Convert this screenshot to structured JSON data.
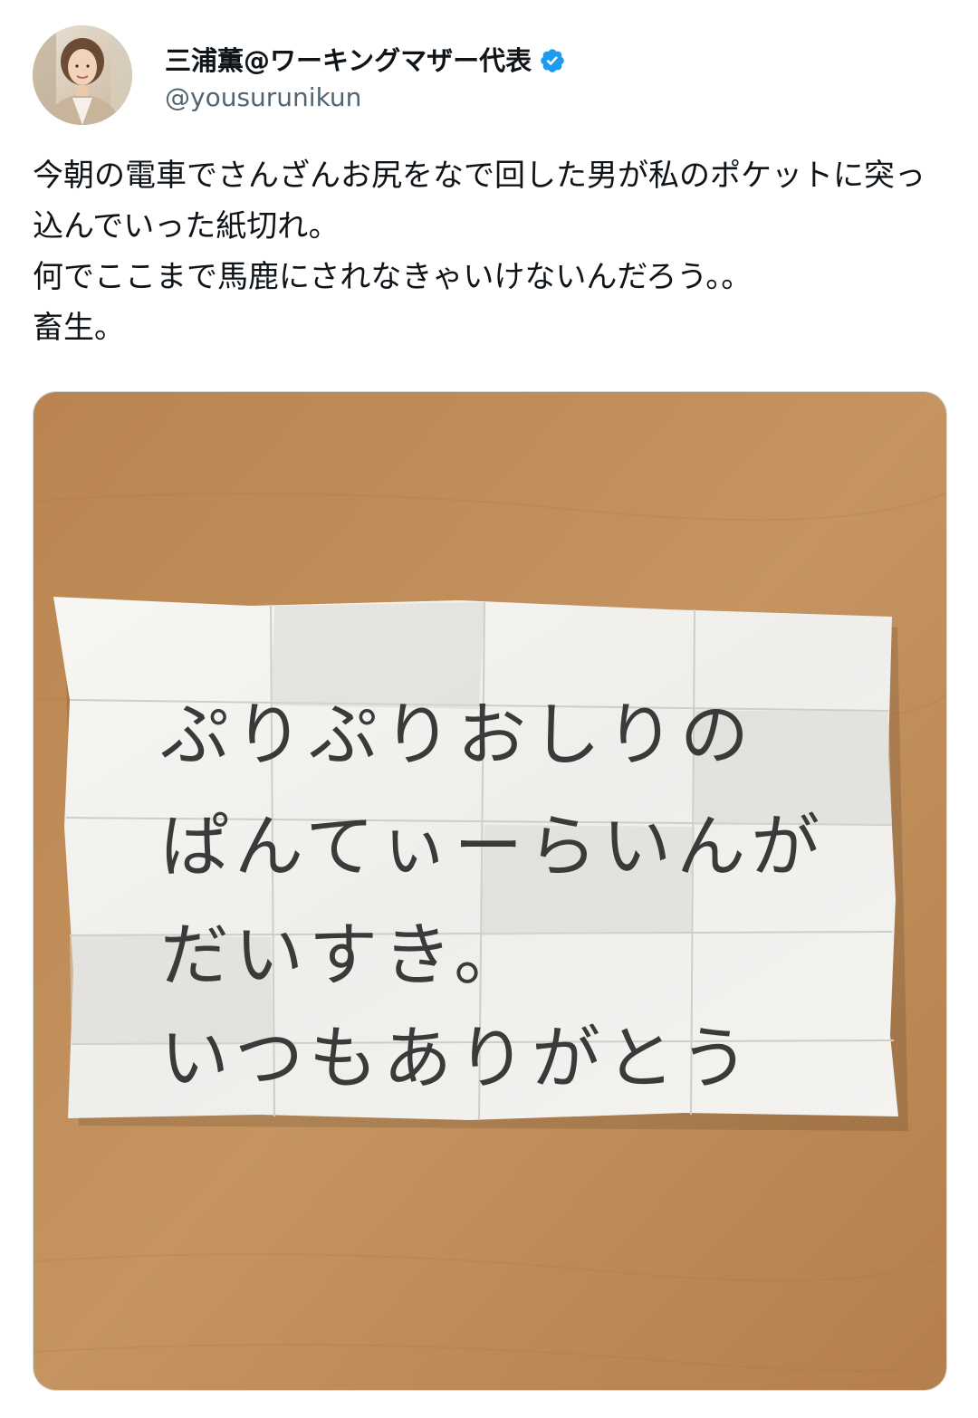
{
  "tweet": {
    "author": {
      "display_name": "三浦薫@ワーキングマザー代表",
      "handle": "@yousurunikun",
      "verified": true,
      "verified_color": "#1d9bf0"
    },
    "text": "今朝の電車でさんざんお尻をなで回した男が私のポケットに突っ込んでいった紙切れ。\n何でここまで馬鹿にされなきゃいけないんだろう。。\n畜生。",
    "media": {
      "note_lines": [
        "ぷりぷりおしりの",
        "ぱんてぃーらいんが",
        "だいすき。",
        "いつもありがとう"
      ]
    }
  },
  "colors": {
    "text": "#0f1419",
    "secondary": "#536471",
    "table": "#c08c55",
    "paper": "#f4f3f0"
  }
}
